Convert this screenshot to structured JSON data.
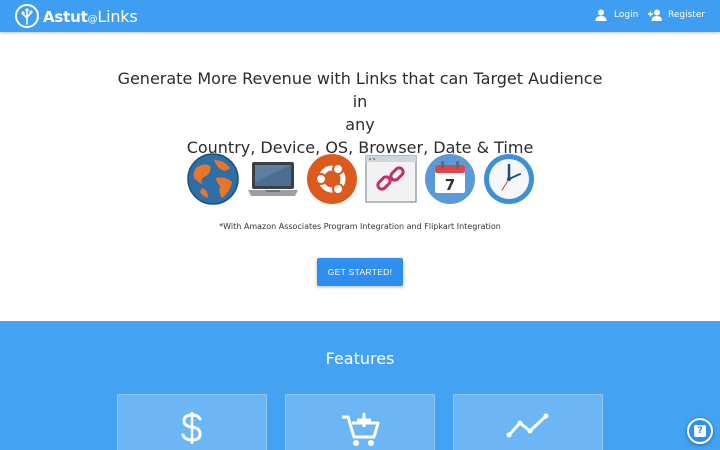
{
  "header": {
    "brand": {
      "part1": "Astut",
      "at": "@",
      "part2": "Links"
    },
    "nav": {
      "login": "Login",
      "register": "Register"
    }
  },
  "hero": {
    "title_line1": "Generate More Revenue with Links that can Target Audience in",
    "title_line2": "any",
    "title_line3": "Country, Device, OS, Browser, Date & Time",
    "icons": [
      "globe-icon",
      "laptop-icon",
      "ubuntu-icon",
      "browser-link-icon",
      "calendar-icon",
      "clock-icon"
    ],
    "calendar_day": "7",
    "note": "*With Amazon Associates Program Integration and Flipkart Integration",
    "cta": "GET STARTED!"
  },
  "features": {
    "title": "Features",
    "cards": [
      "dollar-icon",
      "cart-add-icon",
      "trending-icon"
    ]
  },
  "help": {
    "label": "?"
  },
  "colors": {
    "primary": "#3f9ef2",
    "features_bg": "#44a2f2",
    "card_bg": "#6cb6f5",
    "button": "#2f8ff0"
  }
}
